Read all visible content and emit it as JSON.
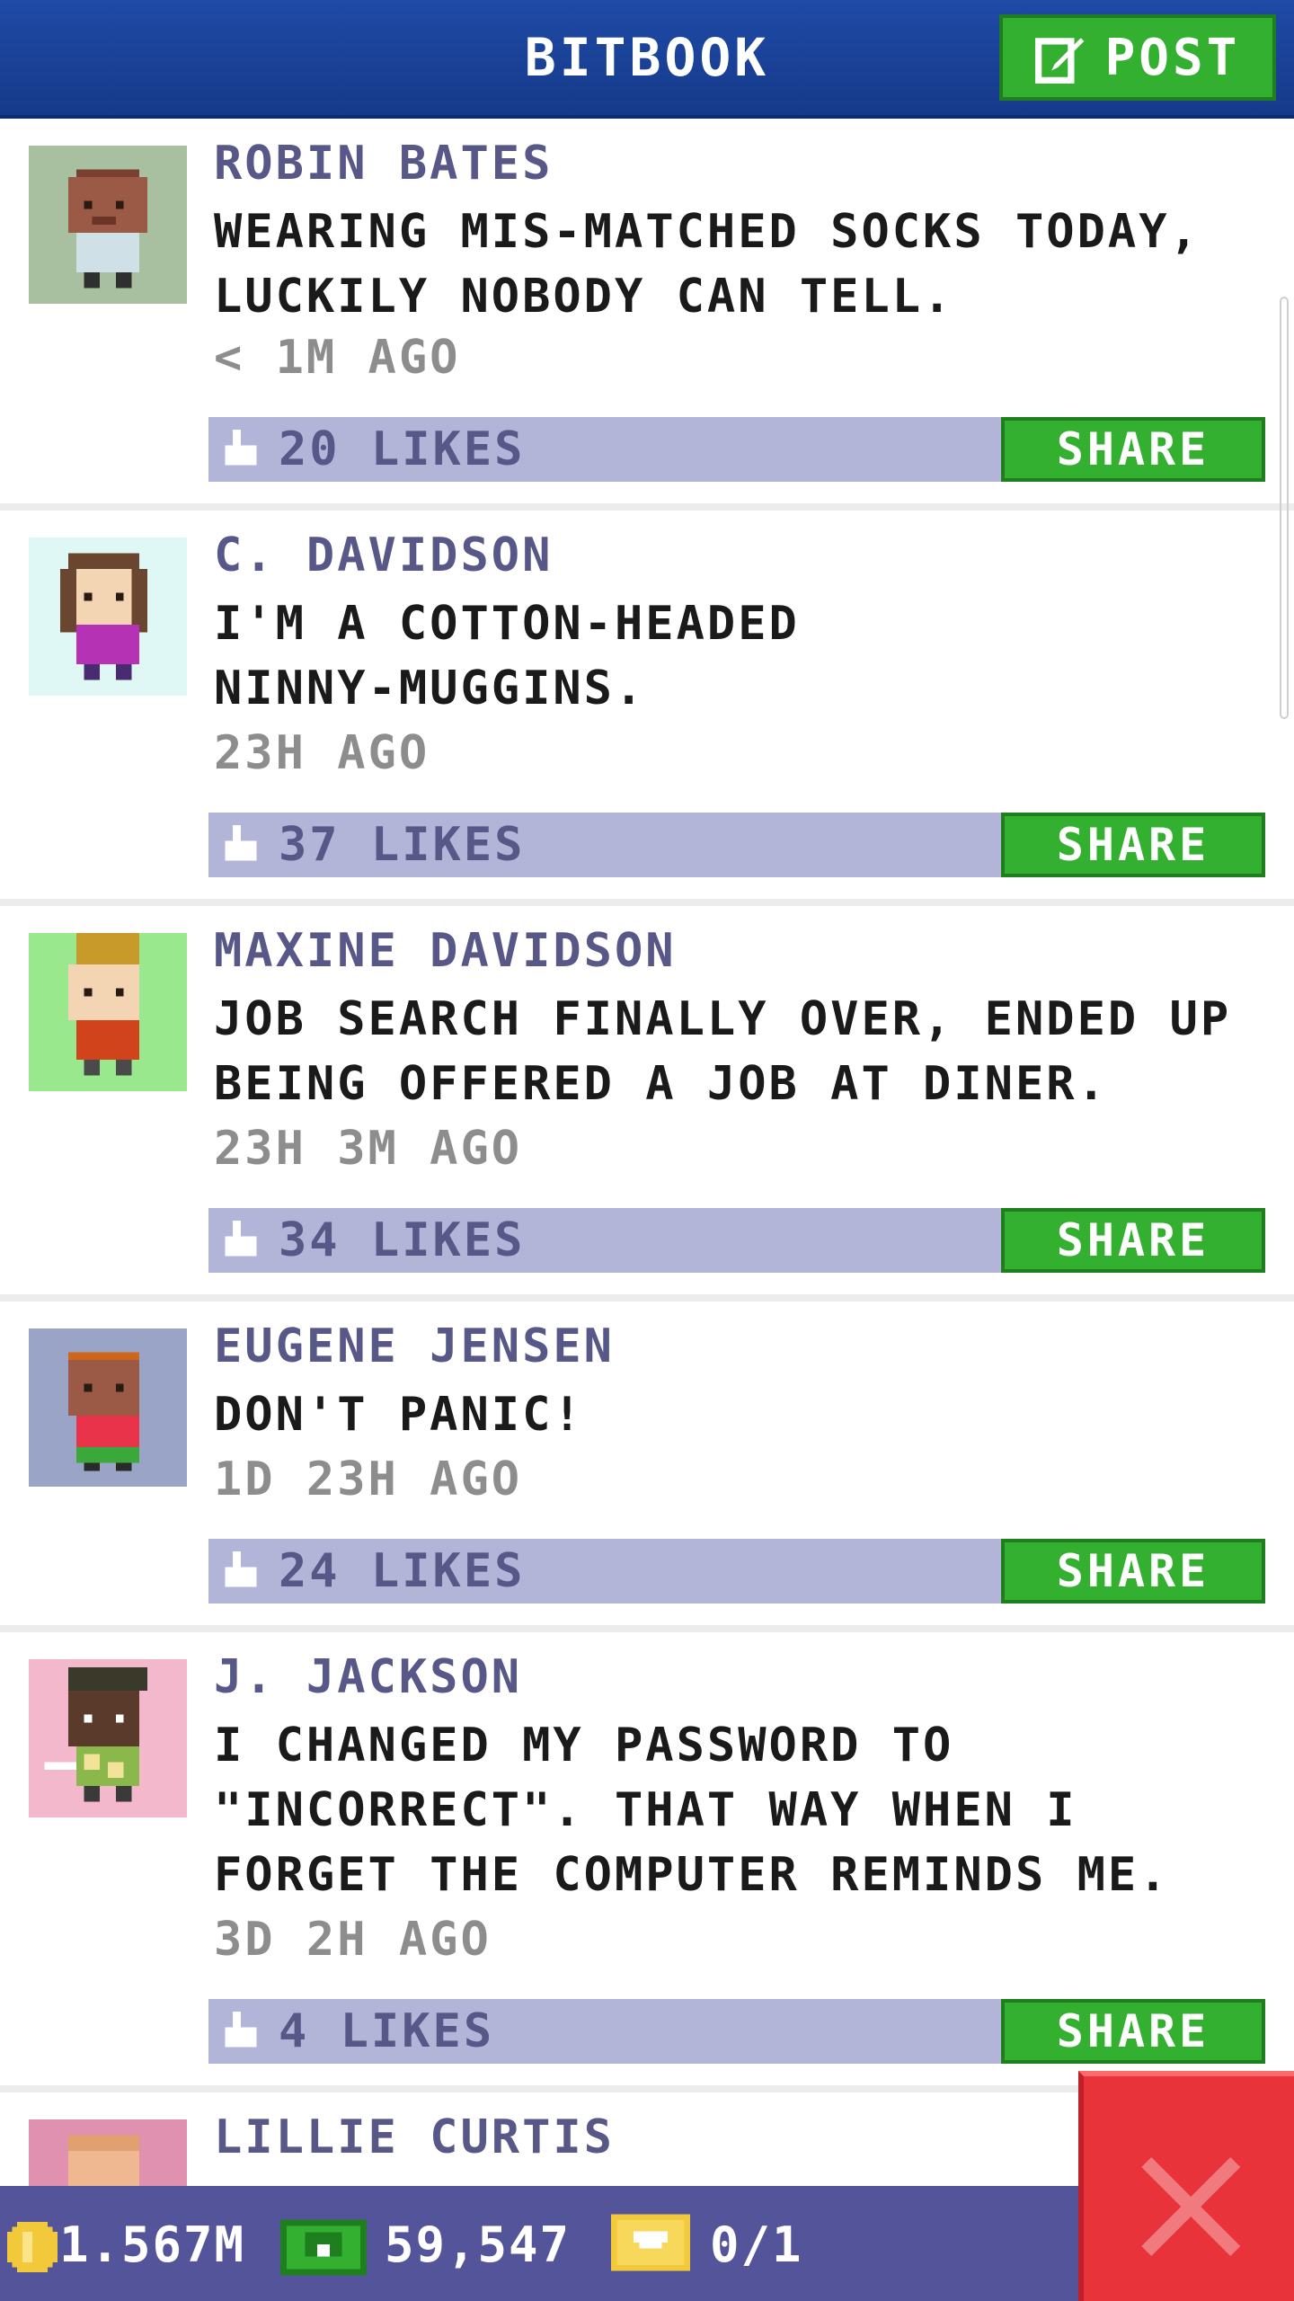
{
  "header": {
    "title": "BITBOOK",
    "post_label": "POST"
  },
  "posts": [
    {
      "author": "ROBIN BATES",
      "text": "WEARING MIS-MATCHED SOCKS TODAY, LUCKILY NOBODY CAN TELL.",
      "time": "< 1M AGO",
      "likes": "20 LIKES",
      "share": "SHARE",
      "avatar_bg": "#a8c0a0",
      "skin": "#9a5a46",
      "hair": "#7a4030",
      "shirt": "#cfe0e6",
      "pants": "#2f2f2f"
    },
    {
      "author": "C. DAVIDSON",
      "text": "I'M A COTTON-HEADED NINNY-MUGGINS.",
      "time": "23H AGO",
      "likes": "37 LIKES",
      "share": "SHARE",
      "avatar_bg": "#dff8f6",
      "skin": "#f3d5b4",
      "hair": "#6a4530",
      "shirt": "#b532b5",
      "pants": "#4a2a70"
    },
    {
      "author": "MAXINE DAVIDSON",
      "text": "JOB SEARCH FINALLY OVER, ENDED UP BEING OFFERED A JOB AT DINER.",
      "time": "23H 3M AGO",
      "likes": "34 LIKES",
      "share": "SHARE",
      "avatar_bg": "#9ae88e",
      "skin": "#f3d5b4",
      "hair": "#c89a2a",
      "shirt": "#d1431a",
      "pants": "#4a4a4a"
    },
    {
      "author": "EUGENE JENSEN",
      "text": "DON'T PANIC!",
      "time": "1D 23H AGO",
      "likes": "24 LIKES",
      "share": "SHARE",
      "avatar_bg": "#9aa4c6",
      "skin": "#9a5a46",
      "hair": "#d0661a",
      "shirt": "#e8334a",
      "pants": "#3aa83a"
    },
    {
      "author": "J. JACKSON",
      "text": "I CHANGED MY PASSWORD TO \"INCORRECT\". THAT WAY WHEN I FORGET THE COMPUTER REMINDS ME.",
      "time": "3D 2H AGO",
      "likes": "4 LIKES",
      "share": "SHARE",
      "avatar_bg": "#f3b8cc",
      "skin": "#5a3a2a",
      "hair": "#3a3a2a",
      "shirt": "#8ab84a",
      "pants": "#3a3a3a"
    },
    {
      "author": "LILLIE CURTIS",
      "text": "",
      "time": "",
      "likes": "",
      "share": "",
      "avatar_bg": "#e091b0",
      "skin": "#f0b890",
      "hair": "#e0a070",
      "shirt": "#ffffff",
      "pants": "#ffffff"
    }
  ],
  "status_bar": {
    "coins": "1.567M",
    "cash": "59,547",
    "tickets": "0/1"
  }
}
